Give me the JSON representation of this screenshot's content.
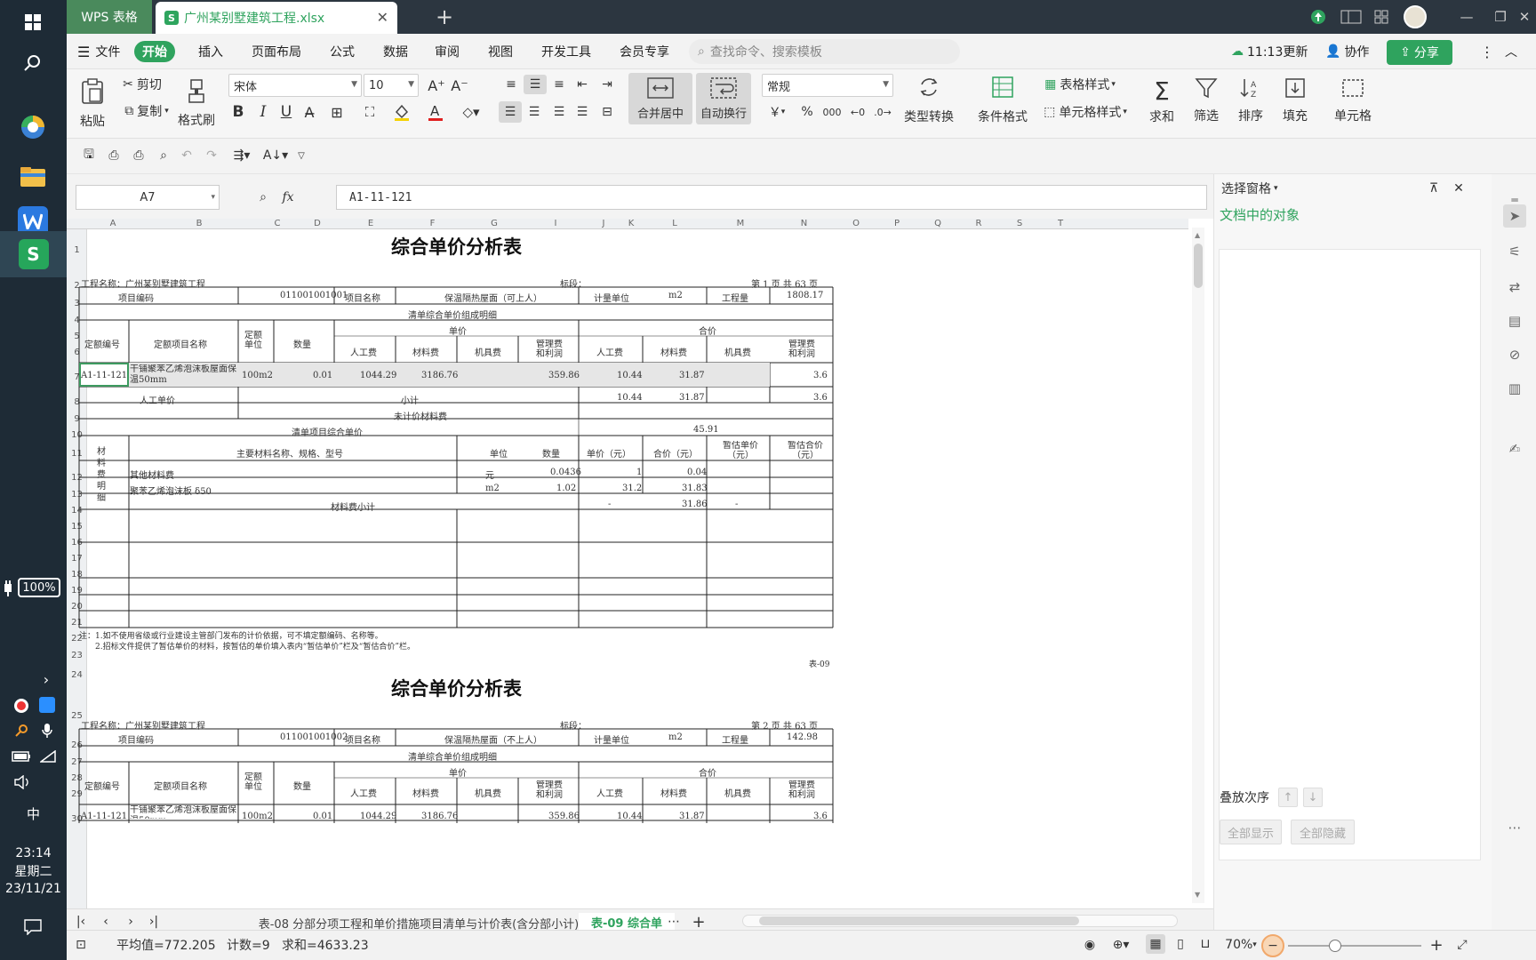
{
  "titlebar": {
    "app_tab": "WPS 表格",
    "file_tab": "广州某别墅建筑工程.xlsx",
    "file_icon_letter": "S"
  },
  "taskbar": {
    "battery": "100%",
    "ime": "中",
    "time": "23:14",
    "weekday": "星期二",
    "date": "23/11/21"
  },
  "menu": {
    "file": "文件",
    "items": [
      "开始",
      "插入",
      "页面布局",
      "公式",
      "数据",
      "审阅",
      "视图",
      "开发工具",
      "会员专享"
    ],
    "search_placeholder": "查找命令、搜索模板",
    "updated": "11:13更新",
    "collab": "协作",
    "share": "分享"
  },
  "ribbon": {
    "paste": "粘贴",
    "cut": "剪切",
    "copy": "复制",
    "format_painter": "格式刷",
    "font_name": "宋体",
    "font_size": "10",
    "merge_center": "合并居中",
    "wrap_text": "自动换行",
    "number_format": "常规",
    "type_convert": "类型转换",
    "conditional_format": "条件格式",
    "table_style": "表格样式",
    "cell_style": "单元格样式",
    "sum": "求和",
    "filter": "筛选",
    "sort": "排序",
    "fill": "填充",
    "cell": "单元格",
    "currency_symbol": "￥",
    "percent_symbol": "%"
  },
  "formula_bar": {
    "name_box": "A7",
    "fx": "fx",
    "formula": "A1-11-121"
  },
  "sheet": {
    "col_letters": [
      "A",
      "B",
      "C",
      "D",
      "E",
      "F",
      "G",
      "I",
      "J",
      "K",
      "L",
      "M",
      "N",
      "O",
      "P",
      "Q",
      "R",
      "S",
      "T"
    ],
    "row_numbers": [
      "1",
      "2",
      "3",
      "4",
      "5",
      "6",
      "7",
      "8",
      "9",
      "10",
      "11",
      "12",
      "13",
      "14",
      "15",
      "16",
      "17",
      "18",
      "19",
      "20",
      "21",
      "22",
      "23",
      "24",
      "25",
      "26",
      "27",
      "28",
      "29",
      "30"
    ],
    "title1": "综合单价分析表",
    "title2": "综合单价分析表",
    "r2_project": "工程名称：广州某别墅建筑工程",
    "r2_section": "标段：",
    "r2_page": "第 1 页  共 63 页",
    "r3": [
      "项目编码",
      "011001001001",
      "项目名称",
      "保温隔热屋面（可上人）",
      "计量单位",
      "m2",
      "工程量",
      "1808.17"
    ],
    "r4": "清单综合单价组成明细",
    "r5_unit_price": "单价",
    "r5_total_price": "合价",
    "r5_6": [
      "定额编号",
      "定额项目名称",
      "定额单位",
      "数量"
    ],
    "r6": [
      "人工费",
      "材料费",
      "机具费",
      "管理费和利润",
      "人工费",
      "材料费",
      "机具费",
      "管理费和利润"
    ],
    "r7": [
      "A1-11-121",
      "干铺聚苯乙烯泡沫板屋面保温50mm",
      "100m2",
      "0.01",
      "1044.29",
      "3186.76",
      "",
      "359.86",
      "10.44",
      "31.87",
      "",
      "3.6"
    ],
    "r8": [
      "人工单价",
      "小计",
      "10.44",
      "31.87",
      "",
      "3.6"
    ],
    "r9": "未计价材料费",
    "r10": [
      "清单项目综合单价",
      "45.91"
    ],
    "r11": [
      "材料费明细",
      "主要材料名称、规格、型号",
      "单位",
      "数量",
      "单价（元）",
      "合价（元）",
      "暂估单价（元）",
      "暂估合价（元）"
    ],
    "r12": [
      "其他材料费",
      "元",
      "0.0436",
      "1",
      "0.04"
    ],
    "r13": [
      "聚苯乙烯泡沫板 δ50",
      "m2",
      "1.02",
      "31.2",
      "31.83"
    ],
    "r14": [
      "材料费小计",
      "-",
      "31.86",
      "-"
    ],
    "note1": "注：1.如不使用省级或行业建设主管部门发布的计价依据，可不填定额编码、名称等。",
    "note2": "2.招标文件提供了暂估单价的材料，按暂估的单价填入表内“暂估单价”栏及“暂估合价”栏。",
    "table_no": "表-09",
    "r25_project": "工程名称：广州某别墅建筑工程",
    "r25_section": "标段：",
    "r25_page": "第 2 页  共 63 页",
    "r26": [
      "项目编码",
      "011001001002",
      "项目名称",
      "保温隔热屋面（不上人）",
      "计量单位",
      "m2",
      "工程量",
      "142.98"
    ],
    "r27": "清单综合单价组成明细",
    "r30": [
      "A1-11-121",
      "干铺聚苯乙烯泡沫板屋面保温50mm",
      "100m2",
      "0.01",
      "1044.29",
      "3186.76",
      "",
      "359.86",
      "10.44",
      "31.87",
      "",
      "3.6"
    ]
  },
  "sheet_tabs": {
    "tab1": "表-08 分部分项工程和单价措施项目清单与计价表(含分部小计)",
    "tab2": "表-09 综合单"
  },
  "status": {
    "average": "平均值=772.205",
    "count": "计数=9",
    "sum": "求和=4633.23",
    "zoom": "70%"
  },
  "panel": {
    "title": "选择窗格",
    "objects": "文档中的对象",
    "order": "叠放次序",
    "show_all": "全部显示",
    "hide_all": "全部隐藏"
  },
  "colors": {
    "accent": "#2fa35e",
    "titlebar": "#2c3640",
    "taskbar": "#1e2b36"
  }
}
